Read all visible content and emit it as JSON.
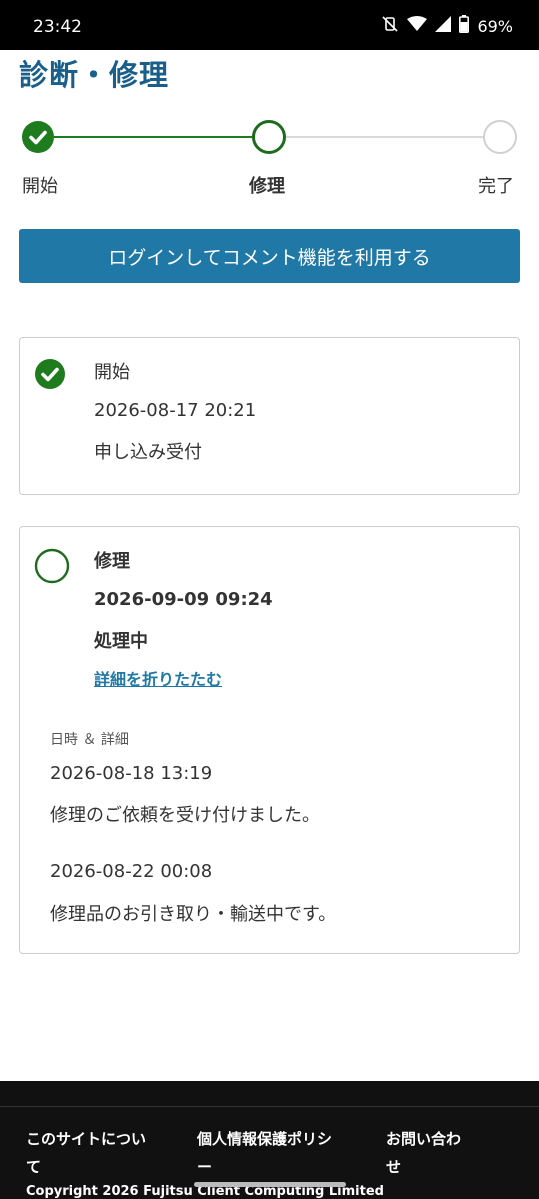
{
  "status_bar": {
    "time": "23:42",
    "battery_percent": "69%"
  },
  "page": {
    "title": "診断・修理"
  },
  "stepper": {
    "steps": [
      {
        "label": "開始",
        "state": "completed"
      },
      {
        "label": "修理",
        "state": "current"
      },
      {
        "label": "完了",
        "state": "pending"
      }
    ]
  },
  "login_button": {
    "label": "ログインしてコメント機能を利用する"
  },
  "cards": [
    {
      "title": "開始",
      "datetime": "2026-08-17 20:21",
      "status": "申し込み受付",
      "state": "completed"
    },
    {
      "title": "修理",
      "datetime": "2026-09-09 09:24",
      "status": "処理中",
      "state": "current",
      "toggle_label": "詳細を折りたたむ",
      "history_header": "日時 ＆ 詳細",
      "history": [
        {
          "datetime": "2026-08-18 13:19",
          "message": "修理のご依頼を受け付けました。"
        },
        {
          "datetime": "2026-08-22 00:08",
          "message": "修理品のお引き取り・輸送中です。"
        }
      ]
    }
  ],
  "footer": {
    "links": [
      {
        "label_line1": "このサイトについ",
        "label_line2": "て"
      },
      {
        "label_line1": "個人情報保護ポリシ",
        "label_line2": "ー"
      },
      {
        "label_line1": "お問い合わ",
        "label_line2": "せ"
      }
    ],
    "copyright": "Copyright 2026 Fujitsu Client Computing Limited"
  },
  "colors": {
    "accent_blue": "#1f78a6",
    "title_blue": "#1a5f8c",
    "success_green": "#1e7b1e",
    "current_green": "#1e6b1e",
    "pending_gray": "#d0d0d0"
  }
}
